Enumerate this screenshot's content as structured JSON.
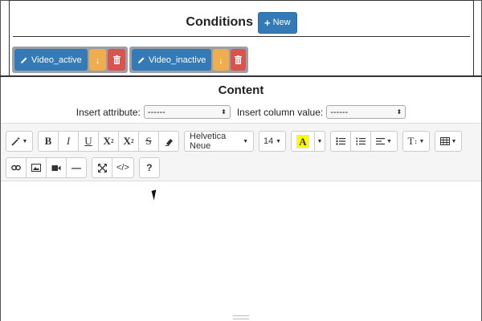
{
  "conditions": {
    "title": "Conditions",
    "new_label": "New",
    "items": [
      {
        "label": "Video_active"
      },
      {
        "label": "Video_inactive"
      }
    ]
  },
  "content": {
    "title": "Content",
    "insert_attribute_label": "Insert attribute:",
    "insert_attribute_value": "------",
    "insert_column_label": "Insert column value:",
    "insert_column_value": "------"
  },
  "toolbar": {
    "bold": "B",
    "italic": "I",
    "underline": "U",
    "superscript": "X",
    "subscript": "X",
    "strikethrough": "S",
    "font_name": "Helvetica Neue",
    "font_size": "14",
    "color_letter": "A",
    "line_height": "T",
    "help": "?"
  },
  "colors": {
    "primary": "#337ab7",
    "warning": "#f0ad4e",
    "danger": "#d9534f",
    "highlight": "#ffff00"
  }
}
